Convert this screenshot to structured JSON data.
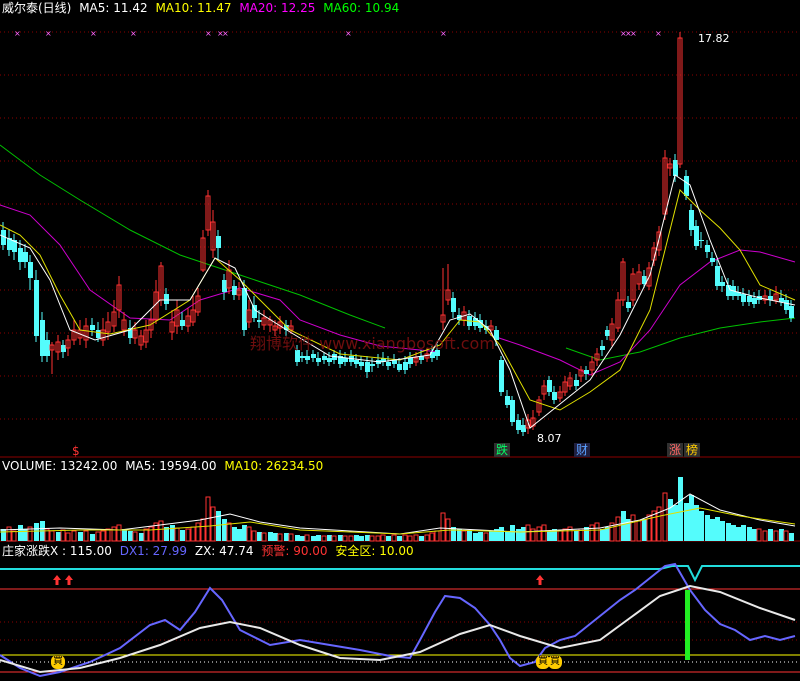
{
  "price_panel": {
    "name": "威尔泰(日线)",
    "indicators": [
      {
        "label": "MA5: 11.42",
        "color": "#ffffff"
      },
      {
        "label": "MA10: 11.47",
        "color": "#ffff00"
      },
      {
        "label": "MA20: 12.25",
        "color": "#ff00ff"
      },
      {
        "label": "MA60: 10.94",
        "color": "#00ff00"
      }
    ],
    "high_label": "17.82",
    "low_label": "8.07",
    "watermark": "翔博软件 www.xiangbosoft.com",
    "events": [
      {
        "text": "$",
        "color": "#ff3333"
      },
      {
        "text": "跌",
        "color": "#00ff66",
        "bg": "#303030"
      },
      {
        "text": "财",
        "color": "#5aa0ff",
        "bg": "#202040"
      },
      {
        "text": "涨",
        "color": "#ff6666",
        "bg": "#303030"
      },
      {
        "text": "榜",
        "color": "#ffcc00",
        "bg": "#303030"
      }
    ]
  },
  "volume_panel": {
    "indicators": [
      {
        "label": "VOLUME: 13242.00",
        "color": "#ffffff"
      },
      {
        "label": "MA5: 19594.00",
        "color": "#ffffff"
      },
      {
        "label": "MA10: 26234.50",
        "color": "#ffff00"
      }
    ]
  },
  "indicator_panel": {
    "indicators": [
      {
        "label": "庄家涨跌X : 115.00",
        "color": "#ffffff"
      },
      {
        "label": "DX1: 27.99",
        "color": "#6666ff"
      },
      {
        "label": "ZX: 47.74",
        "color": "#ffffff"
      },
      {
        "label": "预警: 90.00",
        "color": "#ff3333"
      },
      {
        "label": "安全区: 10.00",
        "color": "#ffff00"
      }
    ],
    "buy_markers": [
      "買",
      "買",
      "買"
    ]
  },
  "colors": {
    "up": "#ff3232",
    "down": "#54fcfc",
    "grid": "#8b0000"
  },
  "chart_data": {
    "type": "candlestick",
    "title": "威尔泰(日线)",
    "price_extremes": {
      "high": 17.82,
      "low": 8.07
    },
    "moving_averages": {
      "MA5": 11.42,
      "MA10": 11.47,
      "MA20": 12.25,
      "MA60": 10.94
    },
    "volume": {
      "VOLUME": 13242.0,
      "MA5": 19594.0,
      "MA10": 26234.5
    },
    "indicator": {
      "X": 115.0,
      "DX1": 27.99,
      "ZX": 47.74,
      "warning": 90.0,
      "safe_zone": 10.0
    }
  }
}
